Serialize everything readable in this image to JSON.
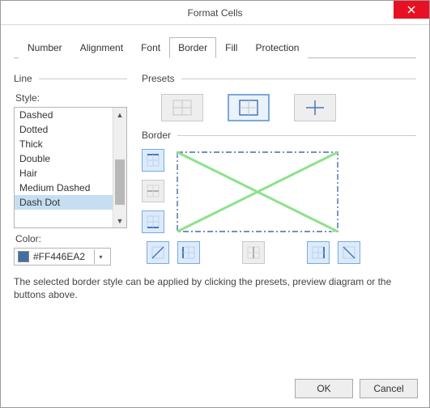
{
  "window": {
    "title": "Format Cells"
  },
  "tabs": {
    "number": "Number",
    "alignment": "Alignment",
    "font": "Font",
    "border": "Border",
    "fill": "Fill",
    "protection": "Protection"
  },
  "line": {
    "section": "Line",
    "style_label": "Style:",
    "styles": [
      "Dashed",
      "Dotted",
      "Thick",
      "Double",
      "Hair",
      "Medium Dashed",
      "Dash Dot"
    ],
    "selected_style": "Dash Dot",
    "color_label": "Color:",
    "color_value": "#FF446EA2",
    "color_swatch": "#446ea2"
  },
  "presets": {
    "section": "Presets",
    "none": "none-preset",
    "outline": "outline-preset",
    "inside": "inside-preset"
  },
  "border": {
    "section": "Border"
  },
  "hint": "The selected border style can be applied by clicking the presets, preview diagram or the buttons above.",
  "buttons": {
    "ok": "OK",
    "cancel": "Cancel"
  }
}
